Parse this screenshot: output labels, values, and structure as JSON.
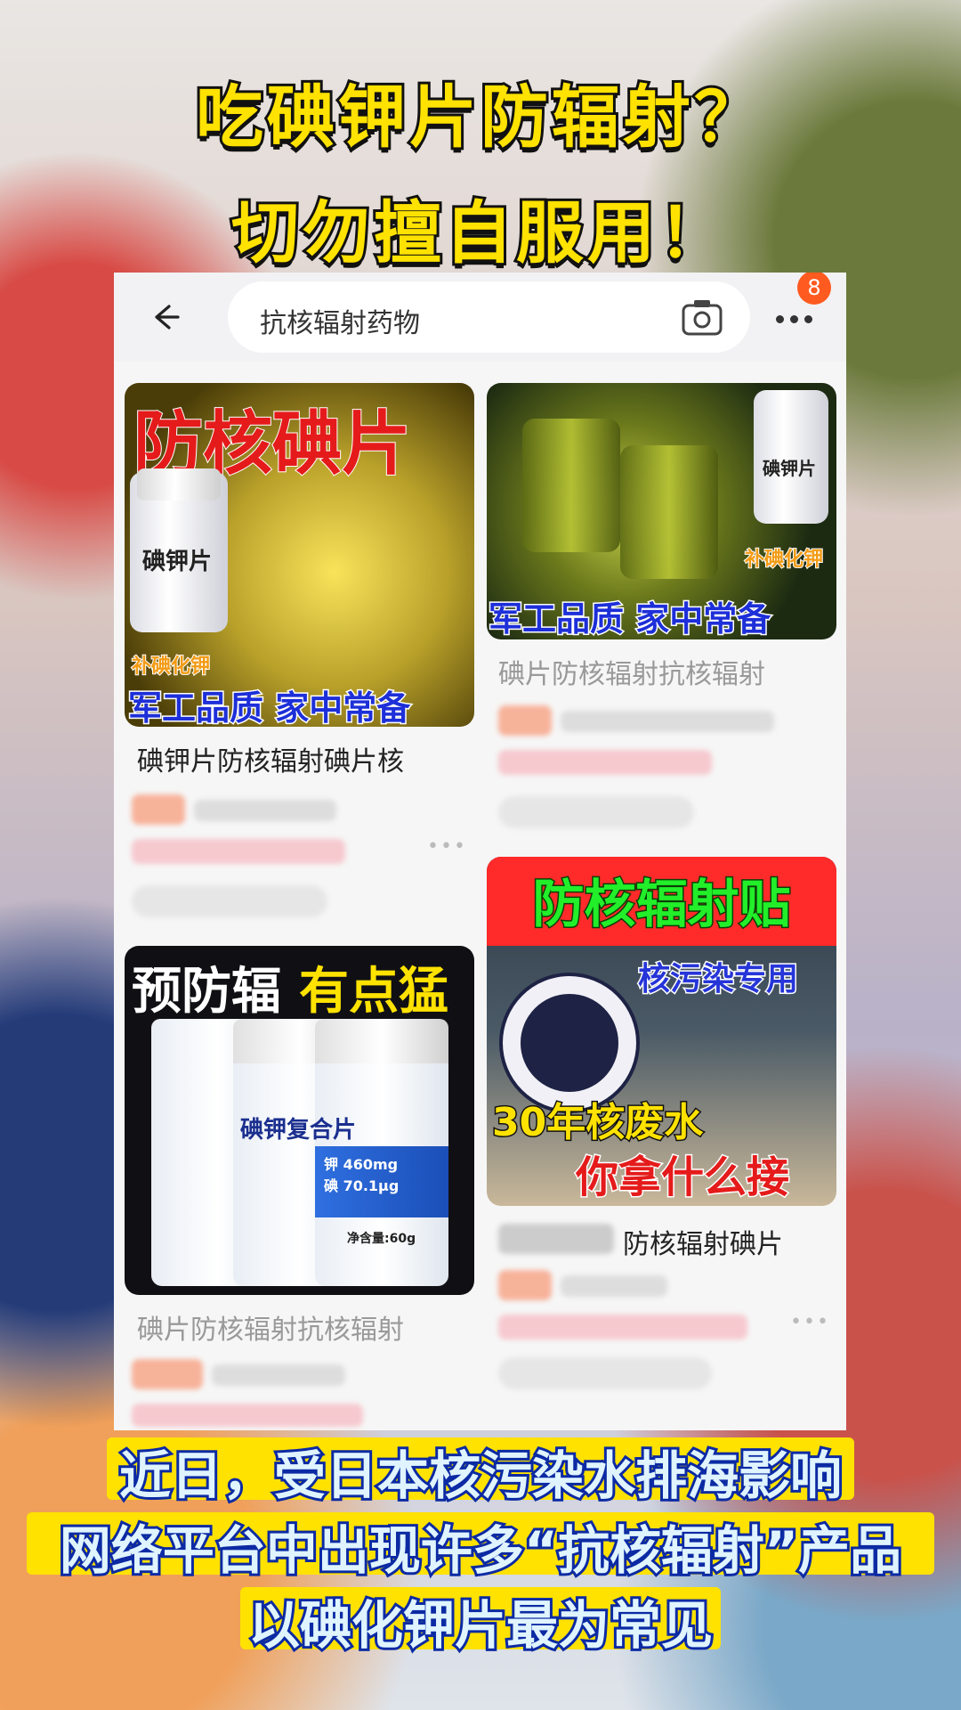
{
  "headline": {
    "line1": "吃碘钾片防辐射？",
    "line2": "切勿擅自服用！"
  },
  "app": {
    "search_query": "抗核辐射药物",
    "notification_count": "8"
  },
  "products": [
    {
      "title": "碘钾片防核辐射碘片核",
      "image_texts": {
        "headline": "防核碘片",
        "bottle_label": "碘钾片",
        "tag": "补碘化钾",
        "slogan": "军工品质 家中常备"
      }
    },
    {
      "title": "碘片防核辐射抗核辐射",
      "image_texts": {
        "bottle_label": "碘钾片",
        "tag": "补碘化钾",
        "slogan": "军工品质 家中常备"
      }
    },
    {
      "title": "碘片防核辐射抗核辐射",
      "image_texts": {
        "headline_left": "预防辐",
        "headline_right": "有点猛",
        "product_name": "碘钾复合片",
        "dose1": "钾 460mg",
        "dose2": "碘 70.1μg",
        "net": "净含量:60g"
      }
    },
    {
      "title": "防核辐射碘片",
      "image_texts": {
        "headline": "防核辐射贴",
        "sub": "核污染专用",
        "line1": "30年核废水",
        "line2": "你拿什么接"
      }
    }
  ],
  "captions": {
    "line1": "近日，受日本核污染水排海影响",
    "line2": "网络平台中出现许多“抗核辐射”产品",
    "line3": "以碘化钾片最为常见"
  },
  "colors": {
    "headline_fill": "#ffe200",
    "caption_fill": "#dff4ff",
    "caption_stroke": "#0c2aa3",
    "badge": "#ff5a1f"
  }
}
